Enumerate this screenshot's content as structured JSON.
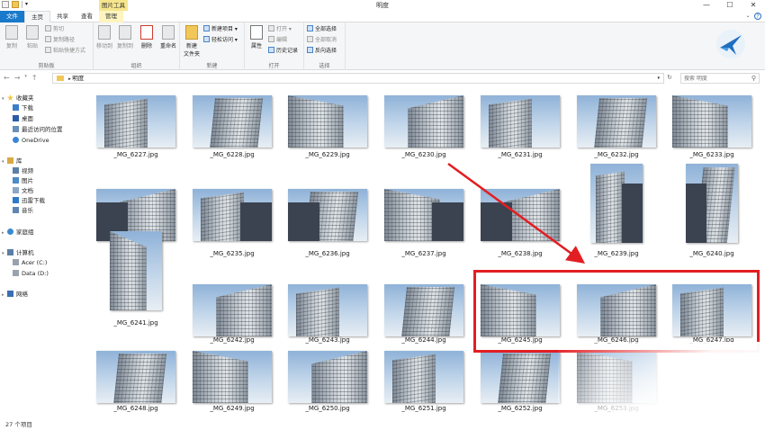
{
  "window": {
    "title": "明度",
    "context_tab": "图片工具",
    "controls": [
      "—",
      "☐",
      "✕"
    ]
  },
  "ribbon_tabs": [
    {
      "label": "文件"
    },
    {
      "label": "主页"
    },
    {
      "label": "共享"
    },
    {
      "label": "查看"
    },
    {
      "label": "管理"
    }
  ],
  "ribbon": {
    "clipboard": {
      "label": "剪贴板",
      "copy": "复制",
      "paste": "粘贴",
      "cut": "剪切",
      "copy_path": "复制路径",
      "paste_shortcut": "粘贴快捷方式"
    },
    "organize": {
      "label": "组织",
      "move_to": "移动到",
      "copy_to": "复制到",
      "delete": "删除",
      "rename": "重命名"
    },
    "new": {
      "label": "新建",
      "new_folder": "新建\n文件夹",
      "new_item": "新建项目",
      "easy_access": "轻松访问"
    },
    "open": {
      "label": "打开",
      "properties": "属性",
      "open": "打开",
      "edit": "编辑",
      "history": "历史记录"
    },
    "select": {
      "label": "选择",
      "select_all": "全部选择",
      "select_none": "全部取消",
      "invert": "反向选择"
    }
  },
  "address": {
    "path": "明度",
    "search_placeholder": "搜索 明度"
  },
  "sidebar": {
    "favorites": "收藏夹",
    "downloads": "下载",
    "desktop": "桌面",
    "recent": "最近访问的位置",
    "onedrive": "OneDrive",
    "libraries": "库",
    "videos": "视频",
    "pictures": "图片",
    "documents": "文档",
    "thunder": "迅雷下载",
    "music": "音乐",
    "homegroup": "家庭组",
    "computer": "计算机",
    "acer": "Acer (C:)",
    "data": "Data (D:)",
    "network": "网络"
  },
  "files": [
    "_MG_6227.jpg",
    "_MG_6228.jpg",
    "_MG_6229.jpg",
    "_MG_6230.jpg",
    "_MG_6231.jpg",
    "_MG_6232.jpg",
    "_MG_6233.jpg",
    "_MG_6234.jpg",
    "_MG_6235.jpg",
    "_MG_6236.jpg",
    "_MG_6237.jpg",
    "_MG_6238.jpg",
    "_MG_6239.jpg",
    "_MG_6240.jpg",
    "_MG_6241.jpg",
    "_MG_6242.jpg",
    "_MG_6243.jpg",
    "_MG_6244.jpg",
    "_MG_6245.jpg",
    "_MG_6246.jpg",
    "_MG_6247.jpg",
    "_MG_6248.jpg",
    "_MG_6249.jpg",
    "_MG_6250.jpg",
    "_MG_6251.jpg",
    "_MG_6252.jpg",
    "_MG_6253.jpg"
  ],
  "status": {
    "item_count": "27 个项目"
  },
  "colors": {
    "file_tab": "#1979ca",
    "highlight": "#e21e22",
    "context_tab": "#f6e58c"
  }
}
